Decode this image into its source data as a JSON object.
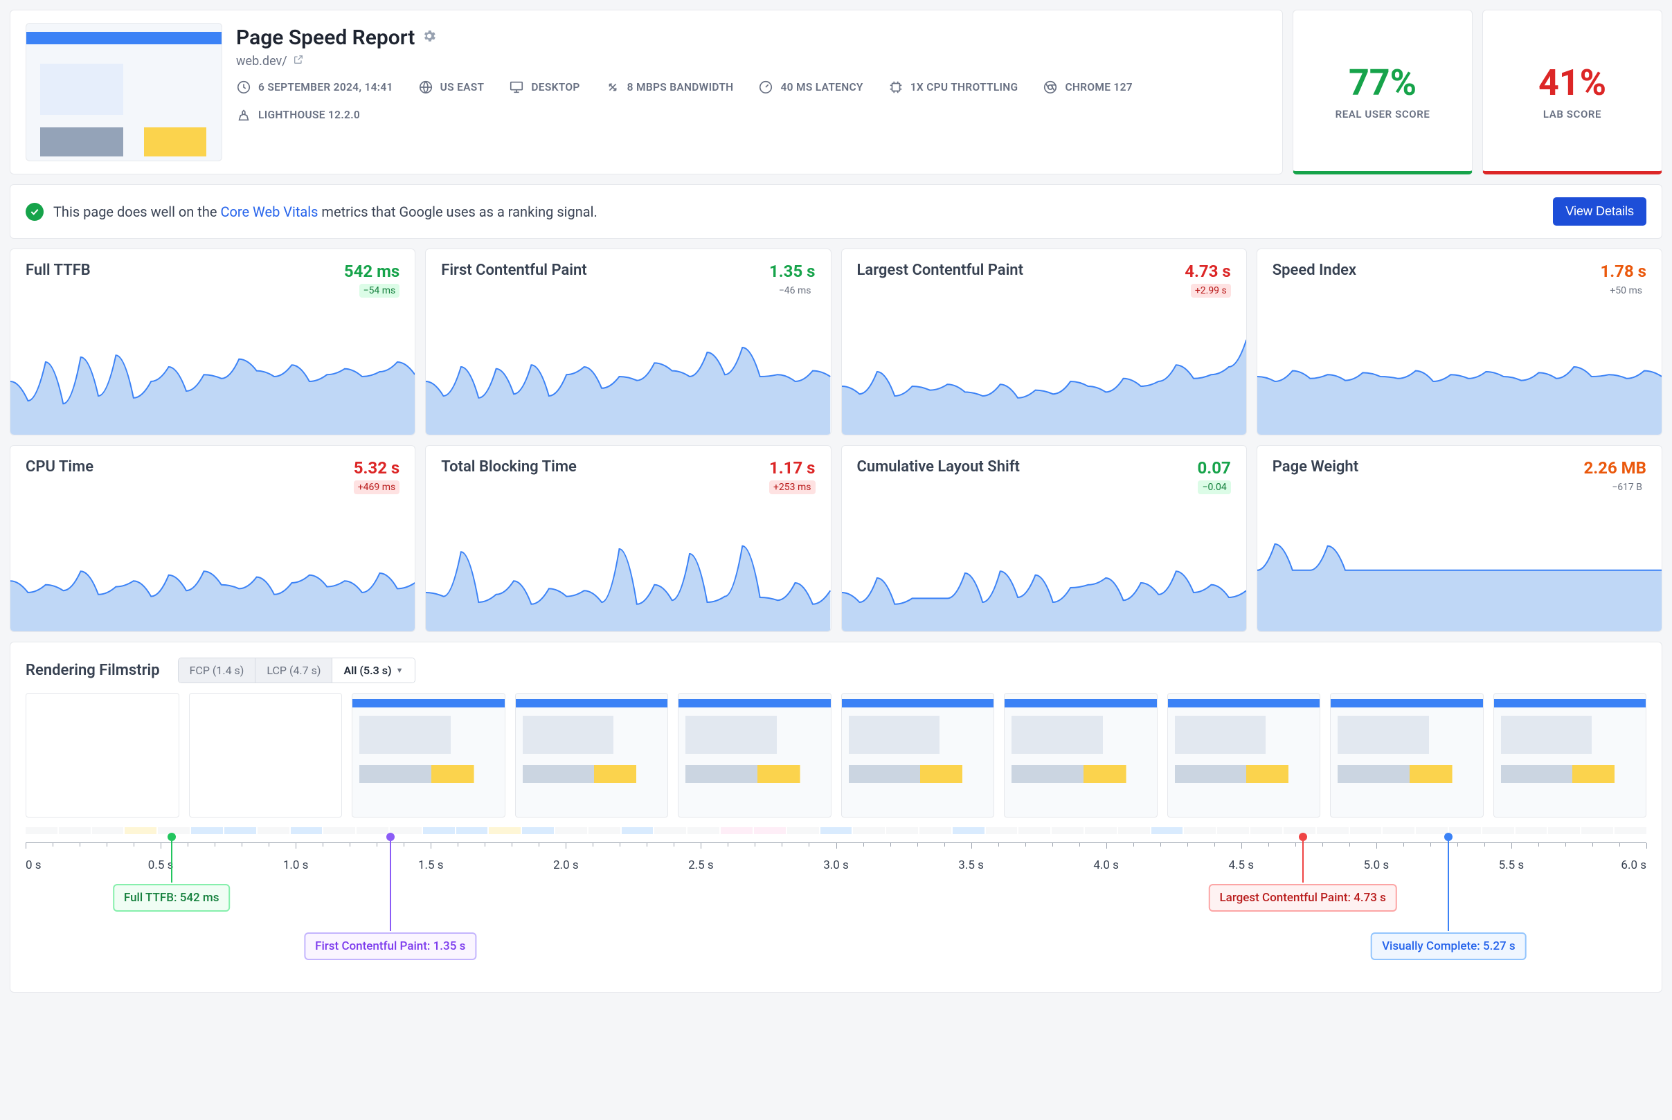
{
  "header": {
    "title": "Page Speed Report",
    "url": "web.dev/",
    "meta": [
      {
        "icon": "clock",
        "text": "6 September 2024, 14:41"
      },
      {
        "icon": "globe",
        "text": "US East"
      },
      {
        "icon": "desktop",
        "text": "Desktop"
      },
      {
        "icon": "swap",
        "text": "8 Mbps Bandwidth"
      },
      {
        "icon": "gauge",
        "text": "40 ms Latency"
      },
      {
        "icon": "chip",
        "text": "1x CPU Throttling"
      },
      {
        "icon": "chrome",
        "text": "Chrome 127"
      },
      {
        "icon": "lh",
        "text": "Lighthouse 12.2.0"
      }
    ]
  },
  "scores": {
    "real": {
      "value": "77%",
      "label": "REAL USER SCORE",
      "tone": "green"
    },
    "lab": {
      "value": "41%",
      "label": "LAB SCORE",
      "tone": "red"
    }
  },
  "notice": {
    "pre": "This page does well on the ",
    "link": "Core Web Vitals",
    "post": " metrics that Google uses as a ranking signal.",
    "button": "View Details"
  },
  "metrics": [
    {
      "name": "Full TTFB",
      "value": "542 ms",
      "tone": "green",
      "delta": "−54 ms",
      "delta_tone": "good"
    },
    {
      "name": "First Contentful Paint",
      "value": "1.35 s",
      "tone": "green",
      "delta": "−46 ms",
      "delta_tone": "neutral"
    },
    {
      "name": "Largest Contentful Paint",
      "value": "4.73 s",
      "tone": "red",
      "delta": "+2.99 s",
      "delta_tone": "bad"
    },
    {
      "name": "Speed Index",
      "value": "1.78 s",
      "tone": "orange",
      "delta": "+50 ms",
      "delta_tone": "neutral"
    },
    {
      "name": "CPU Time",
      "value": "5.32 s",
      "tone": "red",
      "delta": "+469 ms",
      "delta_tone": "bad"
    },
    {
      "name": "Total Blocking Time",
      "value": "1.17 s",
      "tone": "red",
      "delta": "+253 ms",
      "delta_tone": "bad"
    },
    {
      "name": "Cumulative Layout Shift",
      "value": "0.07",
      "tone": "green",
      "delta": "−0.04",
      "delta_tone": "good"
    },
    {
      "name": "Page Weight",
      "value": "2.26 MB",
      "tone": "orange",
      "delta": "−617 B",
      "delta_tone": "neutral"
    }
  ],
  "filmstrip": {
    "title": "Rendering Filmstrip",
    "tabs": [
      {
        "label": "FCP (1.4 s)",
        "active": false
      },
      {
        "label": "LCP (4.7 s)",
        "active": false
      },
      {
        "label": "All (5.3 s)",
        "active": true
      }
    ],
    "frames_filled_from": 2,
    "frame_count": 10,
    "ticks": [
      "0 s",
      "0.5 s",
      "1.0 s",
      "1.5 s",
      "2.0 s",
      "2.5 s",
      "3.0 s",
      "3.5 s",
      "4.0 s",
      "4.5 s",
      "5.0 s",
      "5.5 s",
      "6.0 s"
    ],
    "markers": [
      {
        "pct": 9.0,
        "color": "green",
        "text": "Full TTFB: 542 ms",
        "y": 60
      },
      {
        "pct": 22.5,
        "color": "purple",
        "text": "First Contentful Paint: 1.35 s",
        "y": 130
      },
      {
        "pct": 78.8,
        "color": "red",
        "text": "Largest Contentful Paint: 4.73 s",
        "y": 60
      },
      {
        "pct": 87.8,
        "color": "blue",
        "text": "Visually Complete: 5.27 s",
        "y": 130
      }
    ]
  },
  "chart_data": [
    {
      "type": "area",
      "title": "Full TTFB",
      "ylim": [
        0,
        1
      ],
      "values": [
        0.55,
        0.35,
        0.75,
        0.32,
        0.8,
        0.4,
        0.82,
        0.38,
        0.55,
        0.7,
        0.45,
        0.62,
        0.58,
        0.78,
        0.66,
        0.6,
        0.72,
        0.55,
        0.62,
        0.68,
        0.6,
        0.65,
        0.75,
        0.62
      ]
    },
    {
      "type": "area",
      "title": "First Contentful Paint",
      "ylim": [
        0,
        1
      ],
      "values": [
        0.55,
        0.4,
        0.7,
        0.38,
        0.68,
        0.42,
        0.72,
        0.4,
        0.62,
        0.7,
        0.48,
        0.6,
        0.56,
        0.74,
        0.66,
        0.6,
        0.85,
        0.62,
        0.9,
        0.6,
        0.62,
        0.55,
        0.66,
        0.6
      ]
    },
    {
      "type": "area",
      "title": "Largest Contentful Paint",
      "ylim": [
        0,
        1
      ],
      "values": [
        0.5,
        0.42,
        0.65,
        0.4,
        0.5,
        0.46,
        0.52,
        0.44,
        0.4,
        0.52,
        0.38,
        0.46,
        0.42,
        0.55,
        0.5,
        0.44,
        0.58,
        0.5,
        0.55,
        0.72,
        0.58,
        0.62,
        0.7,
        0.98
      ]
    },
    {
      "type": "area",
      "title": "Speed Index",
      "ylim": [
        0,
        1
      ],
      "values": [
        0.6,
        0.55,
        0.66,
        0.58,
        0.62,
        0.56,
        0.64,
        0.6,
        0.58,
        0.66,
        0.55,
        0.62,
        0.58,
        0.65,
        0.6,
        0.56,
        0.64,
        0.58,
        0.7,
        0.6,
        0.62,
        0.58,
        0.66,
        0.6
      ]
    },
    {
      "type": "area",
      "title": "CPU Time",
      "ylim": [
        0,
        1
      ],
      "values": [
        0.52,
        0.4,
        0.48,
        0.42,
        0.62,
        0.38,
        0.46,
        0.52,
        0.36,
        0.58,
        0.42,
        0.62,
        0.48,
        0.44,
        0.56,
        0.38,
        0.5,
        0.58,
        0.46,
        0.52,
        0.4,
        0.6,
        0.44,
        0.5
      ]
    },
    {
      "type": "area",
      "title": "Total Blocking Time",
      "ylim": [
        0,
        1
      ],
      "values": [
        0.4,
        0.36,
        0.82,
        0.3,
        0.38,
        0.52,
        0.28,
        0.44,
        0.36,
        0.42,
        0.3,
        0.85,
        0.28,
        0.48,
        0.32,
        0.8,
        0.3,
        0.36,
        0.88,
        0.35,
        0.32,
        0.5,
        0.28,
        0.42
      ]
    },
    {
      "type": "area",
      "title": "Cumulative Layout Shift",
      "ylim": [
        0,
        1
      ],
      "values": [
        0.4,
        0.3,
        0.55,
        0.28,
        0.34,
        0.34,
        0.34,
        0.6,
        0.3,
        0.62,
        0.35,
        0.58,
        0.3,
        0.45,
        0.48,
        0.55,
        0.32,
        0.5,
        0.38,
        0.62,
        0.4,
        0.48,
        0.35,
        0.42
      ]
    },
    {
      "type": "area",
      "title": "Page Weight",
      "ylim": [
        0,
        1
      ],
      "values": [
        0.63,
        0.9,
        0.63,
        0.63,
        0.88,
        0.63,
        0.63,
        0.63,
        0.63,
        0.63,
        0.63,
        0.63,
        0.63,
        0.63,
        0.63,
        0.63,
        0.63,
        0.63,
        0.63,
        0.63,
        0.63,
        0.63,
        0.63,
        0.63
      ]
    }
  ]
}
